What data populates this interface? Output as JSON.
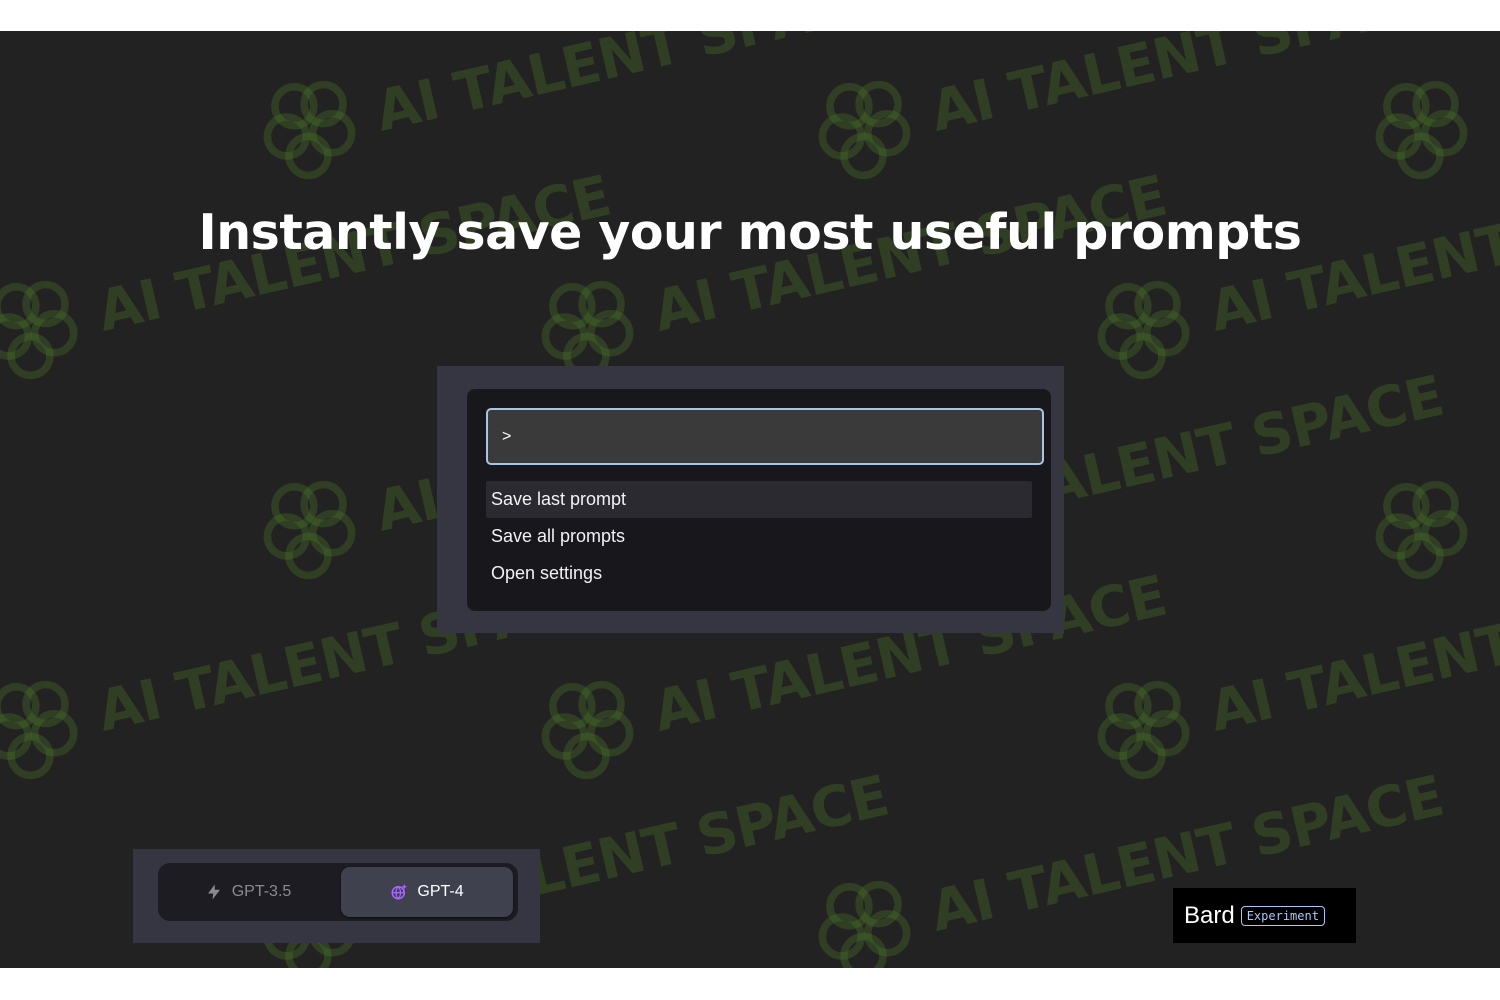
{
  "watermark": {
    "text": "AI TALENT SPACE"
  },
  "headline": "Instantly save your most useful prompts",
  "command_palette": {
    "input_value": ">",
    "items": [
      {
        "label": "Save last prompt",
        "active": true
      },
      {
        "label": "Save all prompts",
        "active": false
      },
      {
        "label": "Open settings",
        "active": false
      }
    ],
    "focus_color": "#a9c4e6"
  },
  "model_switcher": {
    "options": [
      {
        "label": "GPT-3.5",
        "icon": "lightning-icon",
        "selected": false
      },
      {
        "label": "GPT-4",
        "icon": "sparkle-globe-icon",
        "selected": true
      }
    ],
    "accent": "#ab68ff"
  },
  "bard_badge": {
    "name": "Bard",
    "tag": "Experiment",
    "tag_color": "#a8c7fa"
  }
}
